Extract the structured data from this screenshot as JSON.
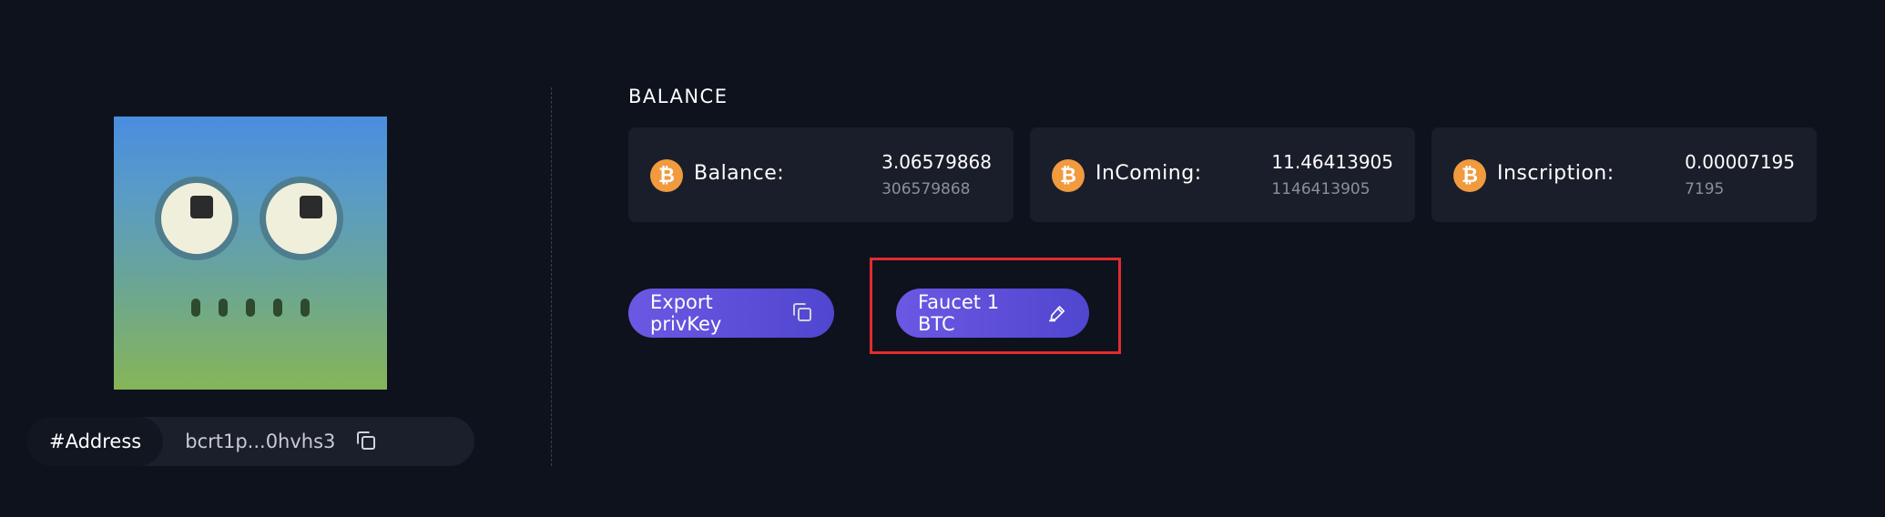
{
  "address": {
    "label": "#Address",
    "value": "bcrt1p...0hvhs3"
  },
  "balance_section": {
    "title": "BALANCE",
    "cards": [
      {
        "label": "Balance:",
        "value": "3.06579868",
        "sub": "306579868",
        "icon": "bitcoin-icon"
      },
      {
        "label": "InComing:",
        "value": "11.46413905",
        "sub": "1146413905",
        "icon": "bitcoin-icon"
      },
      {
        "label": "Inscription:",
        "value": "0.00007195",
        "sub": "7195",
        "icon": "bitcoin-icon"
      }
    ]
  },
  "actions": {
    "export_label": "Export privKey",
    "faucet_label": "Faucet 1 BTC"
  },
  "colors": {
    "background": "#0e121d",
    "card": "#1a1e2a",
    "accent_purple": "#5b4fd8",
    "bitcoin_orange": "#f19a3e",
    "highlight_red": "#e22b2f"
  }
}
